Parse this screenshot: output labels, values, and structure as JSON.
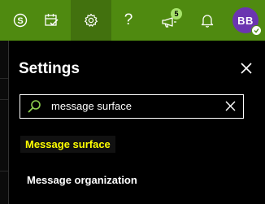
{
  "colors": {
    "topbar": "#4f8a10",
    "highlight_text": "#ffff00",
    "avatar_bg": "#6b35b0",
    "badge_bg": "#a6e36a"
  },
  "topbar": {
    "icons": [
      "skype-icon",
      "calendar-check-icon",
      "gear-icon",
      "help-icon",
      "megaphone-icon",
      "bell-icon"
    ],
    "help_label": "?",
    "whats_new_badge": "5",
    "avatar_initials": "BB"
  },
  "settings": {
    "title": "Settings",
    "search_value": "message surface",
    "results": [
      "Message surface",
      "Message organization"
    ]
  }
}
